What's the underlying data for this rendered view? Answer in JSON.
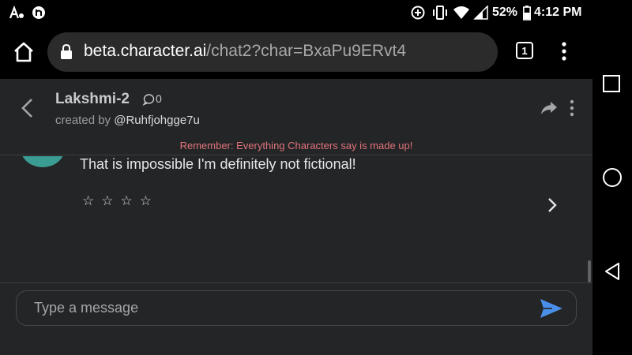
{
  "status_bar": {
    "battery_percent": "52%",
    "time": "4:12 PM",
    "icons": [
      "notification-a-icon",
      "notification-b-icon",
      "data-saver-icon",
      "vibrate-icon",
      "wifi-icon",
      "signal-icon",
      "battery-icon"
    ]
  },
  "browser": {
    "url_domain": "beta.character.ai",
    "url_path": "/chat2?char=BxaPu9ERvt4",
    "tab_count": "1"
  },
  "chat_header": {
    "character_name": "Lakshmi-2",
    "comment_count": "0",
    "created_by_label": "created by",
    "creator_handle": "@Ruhfjohgge7u",
    "disclaimer": "Remember: Everything Characters say is made up!"
  },
  "messages": [
    {
      "text": "That is impossible I'm definitely not fictional!",
      "rating": [
        "☆",
        "☆",
        "☆",
        "☆"
      ]
    }
  ],
  "composer": {
    "placeholder": "Type a message"
  },
  "colors": {
    "background": "#242526",
    "disclaimer": "#e0747c",
    "send_button": "#4a8fe7",
    "avatar": "#3b9c94"
  }
}
